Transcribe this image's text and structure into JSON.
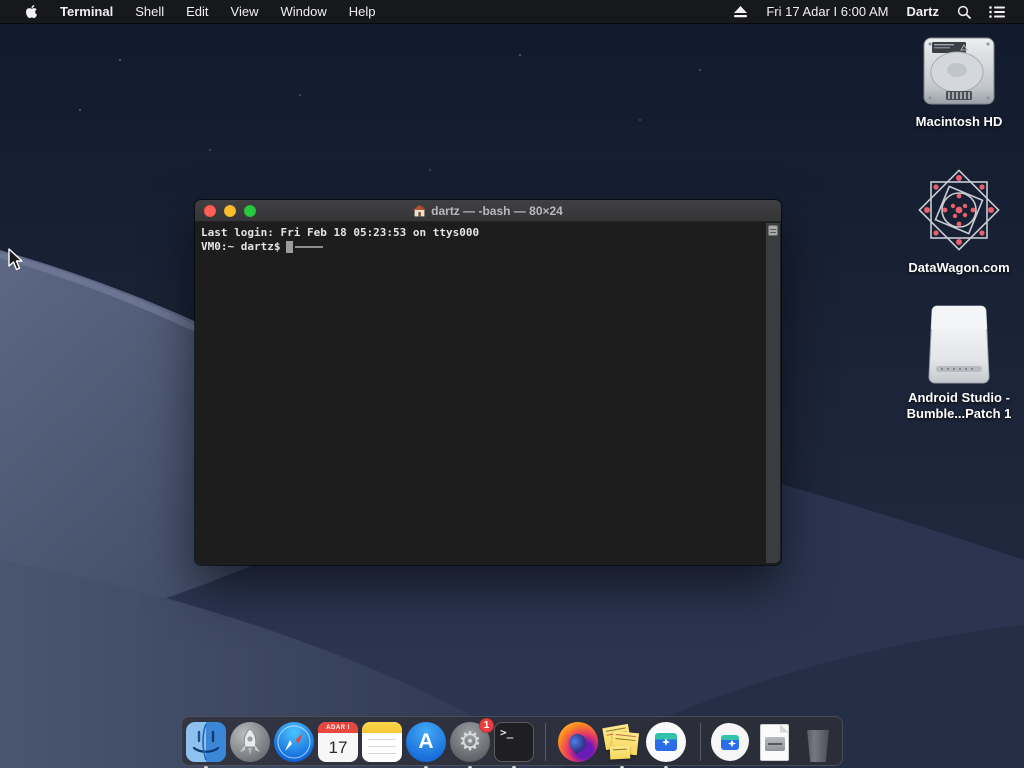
{
  "colors": {
    "menubar_bg": "#18181b",
    "sky_top": "#10182a",
    "sky_bottom": "#273149",
    "dune_light": "#57627e",
    "dune_mid": "#3c4660",
    "dune_dark": "#2b3550",
    "terminal_bg": "#1d1d1d",
    "titlebar_bg": "#3a3a3c",
    "traffic_red": "#ff5f57",
    "traffic_yellow": "#febc2e",
    "traffic_green": "#28c840",
    "badge_red": "#ec4040",
    "dock_bg": "rgba(46,46,52,0.72)"
  },
  "menu_bar": {
    "apple_icon": "apple-logo",
    "app_name": "Terminal",
    "menus": [
      {
        "label": "Shell"
      },
      {
        "label": "Edit"
      },
      {
        "label": "View"
      },
      {
        "label": "Window"
      },
      {
        "label": "Help"
      }
    ],
    "status": {
      "eject_icon": "eject-icon",
      "date_time": "Fri 17 Adar I  6:00 AM",
      "user": "Dartz",
      "search_icon": "spotlight-search-icon",
      "notification_icon": "notification-center-icon"
    }
  },
  "desktop": {
    "icons": [
      {
        "name": "macintosh-hd",
        "icon": "internal-hard-drive-icon",
        "label": "Macintosh HD"
      },
      {
        "name": "datawagon",
        "icon": "network-mandala-icon",
        "label": "DataWagon.com"
      },
      {
        "name": "android-studio-volume",
        "icon": "external-drive-icon",
        "label1": "Android Studio -",
        "label2": "Bumble...Patch 1"
      }
    ]
  },
  "terminal_window": {
    "proxy_icon": "home-folder-icon",
    "title": "dartz — -bash — 80×24",
    "line1": "Last login: Fri Feb 18 05:23:53 on ttys000",
    "prompt": "VM0:~ dartz$"
  },
  "dock": {
    "items": [
      {
        "name": "finder",
        "running": true
      },
      {
        "name": "launchpad",
        "running": false
      },
      {
        "name": "safari",
        "running": false
      },
      {
        "name": "calendar",
        "running": false,
        "month": "ADAR I",
        "day": "17"
      },
      {
        "name": "notes",
        "running": false
      },
      {
        "name": "app-store",
        "running": true
      },
      {
        "name": "system-preferences",
        "running": true,
        "badge": "1"
      },
      {
        "name": "terminal",
        "running": true
      },
      {
        "name": "firefox",
        "running": false
      },
      {
        "name": "stickies",
        "running": true
      },
      {
        "name": "android-studio",
        "running": true
      },
      {
        "name": "android-studio-installer",
        "running": false
      },
      {
        "name": "disk-image-file",
        "running": false
      },
      {
        "name": "trash",
        "running": false
      }
    ],
    "terminal_glyph": ">_"
  }
}
